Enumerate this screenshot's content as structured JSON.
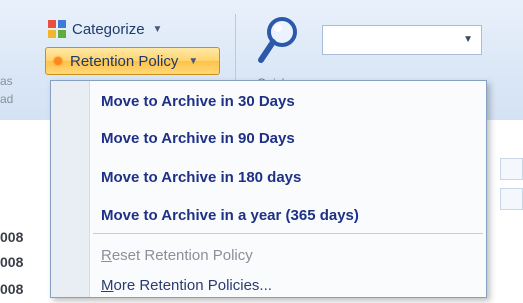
{
  "ribbon": {
    "edge_labels": [
      "as",
      "ad"
    ],
    "categorize_label": "Categorize",
    "retention_label": "Retention Policy",
    "quick_label": "Quick",
    "search_placeholder": ""
  },
  "left_column": {
    "years": [
      "008",
      "008",
      "008"
    ]
  },
  "menu": {
    "items": [
      {
        "label": "Move to Archive in 30 Days"
      },
      {
        "label": "Move to Archive in 90 Days"
      },
      {
        "label": "Move to Archive in 180 days"
      },
      {
        "label": "Move to Archive in a year (365 days)"
      }
    ],
    "reset_first": "R",
    "reset_rest": "eset Retention Policy",
    "more_first": "M",
    "more_rest": "ore Retention Policies..."
  }
}
